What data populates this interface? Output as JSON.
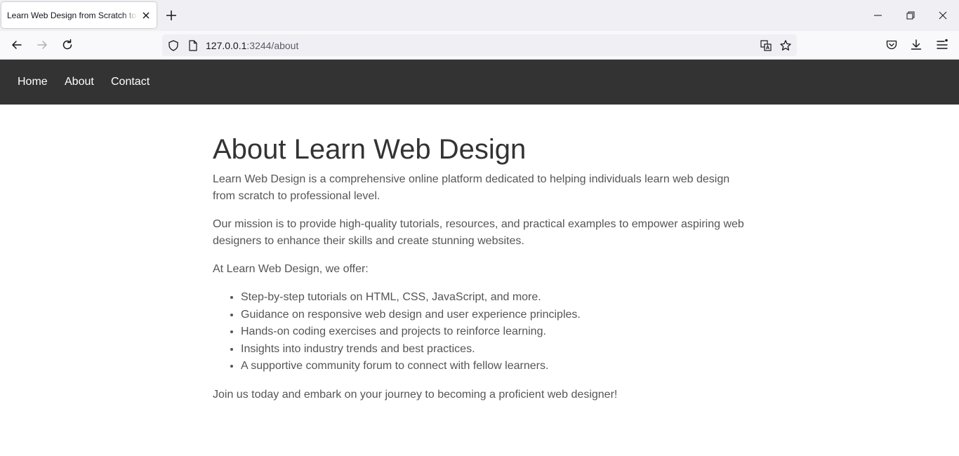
{
  "browser": {
    "tab_title": "Learn Web Design from Scratch to Professional",
    "url_host": "127.0.0.1",
    "url_rest": ":3244/about"
  },
  "site_nav": {
    "home": "Home",
    "about": "About",
    "contact": "Contact"
  },
  "page": {
    "title": "About Learn Web Design",
    "intro": "Learn Web Design is a comprehensive online platform dedicated to helping individuals learn web design from scratch to professional level.",
    "mission": "Our mission is to provide high-quality tutorials, resources, and practical examples to empower aspiring web designers to enhance their skills and create stunning websites.",
    "offer_intro": "At Learn Web Design, we offer:",
    "offers": [
      "Step-by-step tutorials on HTML, CSS, JavaScript, and more.",
      "Guidance on responsive web design and user experience principles.",
      "Hands-on coding exercises and projects to reinforce learning.",
      "Insights into industry trends and best practices.",
      "A supportive community forum to connect with fellow learners."
    ],
    "closing": "Join us today and embark on your journey to becoming a proficient web designer!"
  },
  "colors": {
    "header_bg": "#333333",
    "heading": "#333333",
    "body_text": "#555555"
  }
}
